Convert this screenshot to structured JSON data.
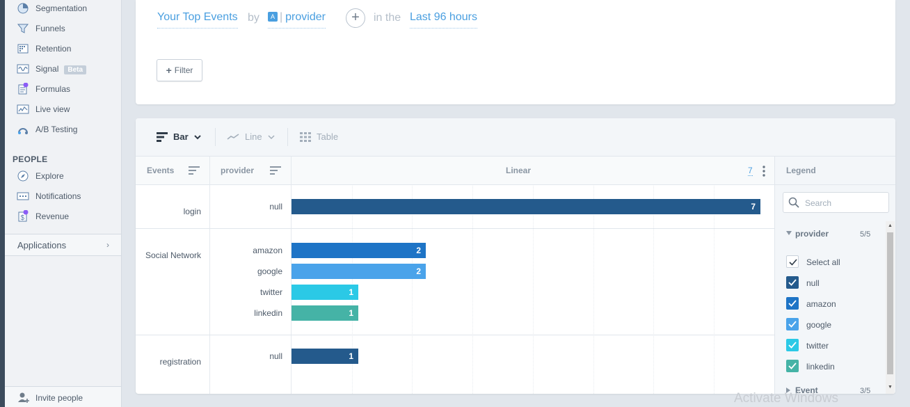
{
  "sidebar": {
    "items": [
      {
        "label": "Segmentation"
      },
      {
        "label": "Funnels"
      },
      {
        "label": "Retention"
      },
      {
        "label": "Signal",
        "badge": "Beta"
      },
      {
        "label": "Formulas"
      },
      {
        "label": "Live view"
      },
      {
        "label": "A/B Testing"
      }
    ],
    "people_heading": "PEOPLE",
    "people_items": [
      {
        "label": "Explore"
      },
      {
        "label": "Notifications"
      },
      {
        "label": "Revenue"
      }
    ],
    "applications": "Applications",
    "invite": "Invite people"
  },
  "query": {
    "events": "Your Top Events",
    "by": "by",
    "property_badge": "A",
    "property": "provider",
    "in_the": "in the",
    "time": "Last 96 hours",
    "filter_label": "Filter"
  },
  "toolbar": {
    "bar": "Bar",
    "line": "Line",
    "table": "Table"
  },
  "table": {
    "col_events": "Events",
    "col_provider": "provider",
    "col_scale": "Linear",
    "scale_max": "7"
  },
  "chart_data": {
    "type": "bar",
    "orientation": "horizontal",
    "x_max": 9,
    "rows": [
      {
        "event": "login",
        "provider": "null",
        "value": 7
      },
      {
        "event": "Social Network",
        "provider": "amazon",
        "value": 2
      },
      {
        "event": "",
        "provider": "google",
        "value": 2
      },
      {
        "event": "",
        "provider": "twitter",
        "value": 1
      },
      {
        "event": "",
        "provider": "linkedin",
        "value": 1
      },
      {
        "event": "registration",
        "provider": "null",
        "value": 1
      }
    ],
    "colors": {
      "null": "#245a8c",
      "amazon": "#1e74c6",
      "google": "#4aa3ea",
      "twitter": "#2bc9e6",
      "linkedin": "#45b3a6"
    }
  },
  "legend": {
    "title": "Legend",
    "search_placeholder": "Search",
    "group1": "provider",
    "group1_count": "5/5",
    "select_all": "Select all",
    "items": [
      {
        "label": "null",
        "color": "#245a8c"
      },
      {
        "label": "amazon",
        "color": "#1e74c6"
      },
      {
        "label": "google",
        "color": "#4aa3ea"
      },
      {
        "label": "twitter",
        "color": "#2bc9e6"
      },
      {
        "label": "linkedin",
        "color": "#45b3a6"
      }
    ],
    "group2": "Event",
    "group2_count": "3/5"
  },
  "watermark": "Activate Windows"
}
